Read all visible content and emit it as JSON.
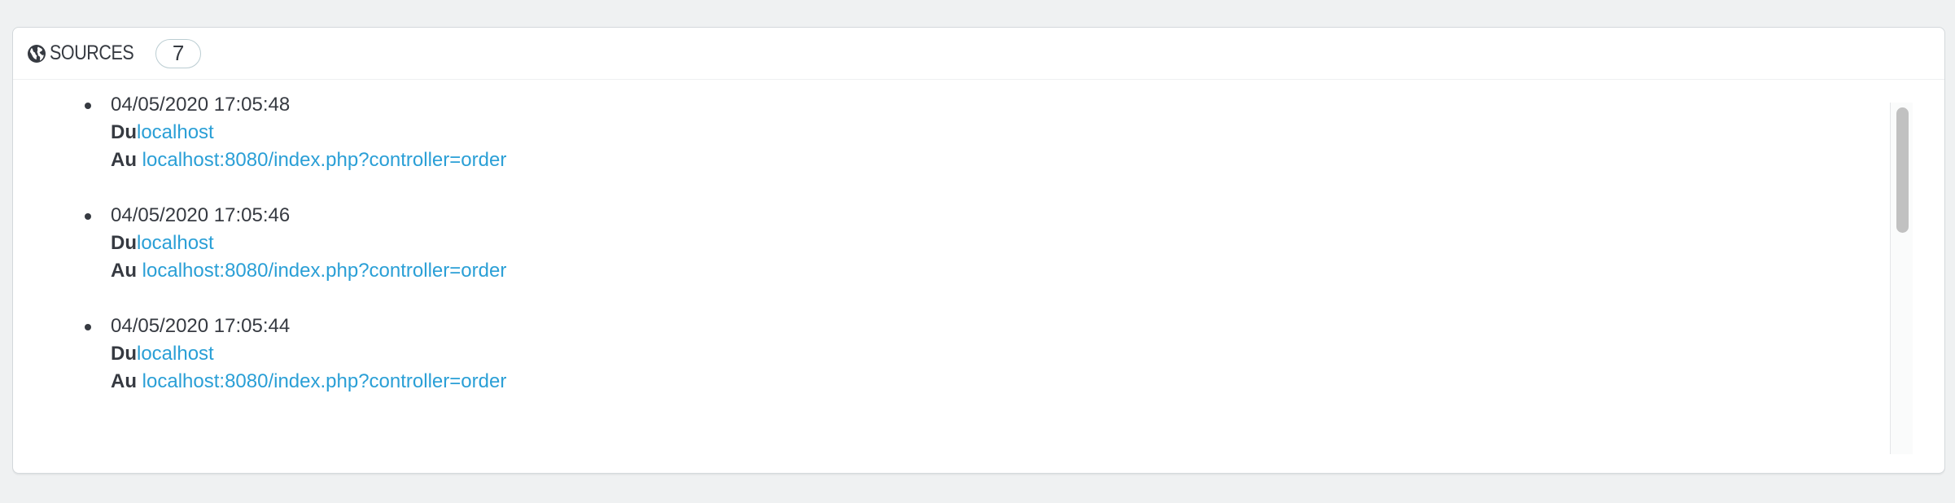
{
  "panel": {
    "title": "SOURCES",
    "count": "7",
    "icon": "globe-icon"
  },
  "sources": [
    {
      "date": "04/05/2020 17:05:48",
      "from_label": "Du",
      "from_link": "localhost",
      "to_label": "Au",
      "to_link": "localhost:8080/index.php?controller=order"
    },
    {
      "date": "04/05/2020 17:05:46",
      "from_label": "Du",
      "from_link": "localhost",
      "to_label": "Au",
      "to_link": "localhost:8080/index.php?controller=order"
    },
    {
      "date": "04/05/2020 17:05:44",
      "from_label": "Du",
      "from_link": "localhost",
      "to_label": "Au",
      "to_link": "localhost:8080/index.php?controller=order"
    }
  ],
  "colors": {
    "link": "#2a9fd6",
    "text": "#363a41",
    "background": "#eff1f2"
  }
}
